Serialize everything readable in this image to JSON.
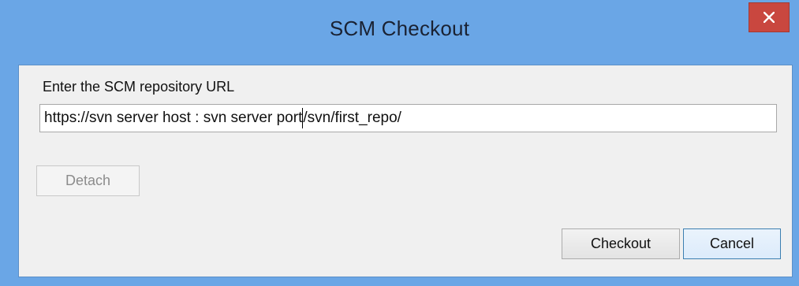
{
  "window": {
    "title": "SCM Checkout",
    "close_icon": "close-icon",
    "colors": {
      "titlebar": "#6aa6e6",
      "close_button": "#c9473f",
      "client_background": "#f0f0f0"
    }
  },
  "form": {
    "url_label": "Enter the SCM repository URL",
    "url_value_before_caret": "https://svn server host : svn server port",
    "url_value_after_caret": "/svn/first_repo/"
  },
  "buttons": {
    "detach_label": "Detach",
    "checkout_label": "Checkout",
    "cancel_label": "Cancel"
  }
}
